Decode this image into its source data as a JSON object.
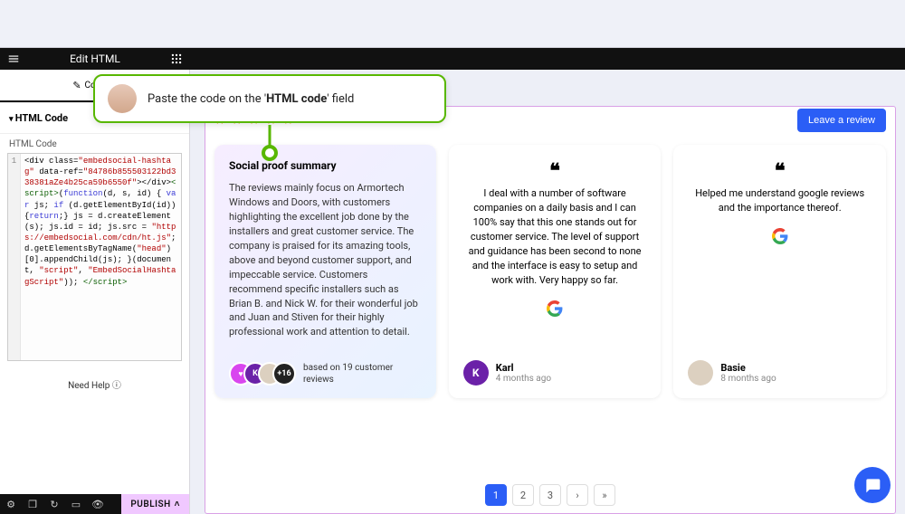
{
  "titlebar": {
    "title": "Edit HTML"
  },
  "left": {
    "tab_label": "Content",
    "section_title": "HTML Code",
    "field_label": "HTML Code",
    "code_line_number": "1",
    "code": {
      "p1": "<div class=",
      "s1": "\"embedsocial-hashtag\"",
      "p2": " data-ref=",
      "s2": "\"84786b855503122bd338381aZe4b25ca59b6550f\"",
      "p3": "></div>",
      "tag_open": "<script>",
      "p4": "(",
      "kw1": "function",
      "p5": "(d, s, id) { ",
      "kw2": "var",
      "p6": " js; ",
      "kw3": "if",
      "p7": " (d.getElementById(id)){",
      "kw4": "return",
      "p8": ";} js = d.createElement(s); js.id = id; js.src = ",
      "s3": "\"https://embedsocial.com/cdn/ht.js\"",
      "p9": "; d.getElementsByTagName(",
      "s4": "\"head\"",
      "p10": ")[0].appendChild(js); }(document, ",
      "s5": "\"script\"",
      "p11": ", ",
      "s6": "\"EmbedSocialHashtagScript\"",
      "p12": ")); ",
      "tag_close": "</script>"
    },
    "need_help": "Need Help",
    "publish": "PUBLISH"
  },
  "callout": {
    "text_prefix": "Paste the code on the '",
    "text_bold": "HTML code",
    "text_suffix": "' field"
  },
  "preview": {
    "stars": "★ ★ ★ ★ ★",
    "leave_review": "Leave a review",
    "summary": {
      "title": "Social proof summary",
      "body": "The reviews mainly focus on Armortech Windows and Doors, with customers highlighting the excellent job done by the installers and great customer service. The company is praised for its amazing tools, above and beyond customer support, and impeccable service. Customers recommend specific installers such as Brian B. and Nick W. for their wonderful job and Juan and Stiven for their highly professional work and attention to detail.",
      "more_count": "+16",
      "based_on": "based on 19 customer reviews",
      "avatar_letter": "K"
    },
    "review1": {
      "quote": "❝",
      "text": "I deal with a number of software companies on a daily basis and I can 100% say that this one stands out for customer service. The level of support and guidance has been second to none and the interface is easy to setup and work with. Very happy so far.",
      "name": "Karl",
      "time": "4 months ago",
      "avatar_letter": "K"
    },
    "review2": {
      "quote": "❝",
      "text": "Helped me understand google reviews and the importance thereof.",
      "name": "Basie",
      "time": "8 months ago"
    },
    "pagination": [
      "1",
      "2",
      "3",
      "›",
      "»"
    ]
  }
}
